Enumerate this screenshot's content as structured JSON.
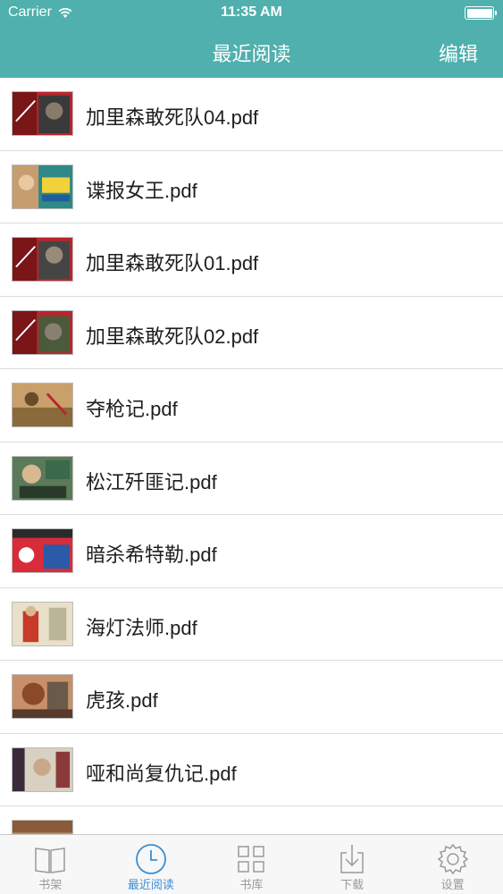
{
  "status_bar": {
    "carrier": "Carrier",
    "time": "11:35 AM"
  },
  "nav": {
    "title": "最近阅读",
    "edit_label": "编辑"
  },
  "items": [
    {
      "title": "加里森敢死队04.pdf"
    },
    {
      "title": "谍报女王.pdf"
    },
    {
      "title": "加里森敢死队01.pdf"
    },
    {
      "title": "加里森敢死队02.pdf"
    },
    {
      "title": "夺枪记.pdf"
    },
    {
      "title": "松江歼匪记.pdf"
    },
    {
      "title": "暗杀希特勒.pdf"
    },
    {
      "title": "海灯法师.pdf"
    },
    {
      "title": "虎孩.pdf"
    },
    {
      "title": "哑和尚复仇记.pdf"
    },
    {
      "title": ""
    }
  ],
  "tabs": [
    {
      "label": "书架",
      "icon": "book-icon"
    },
    {
      "label": "最近阅读",
      "icon": "clock-icon"
    },
    {
      "label": "书库",
      "icon": "grid-icon"
    },
    {
      "label": "下载",
      "icon": "download-icon"
    },
    {
      "label": "设置",
      "icon": "gear-icon"
    }
  ],
  "colors": {
    "header": "#4fb0ae",
    "active_tab": "#3b8fd3",
    "inactive_tab": "#9a9a9a"
  }
}
